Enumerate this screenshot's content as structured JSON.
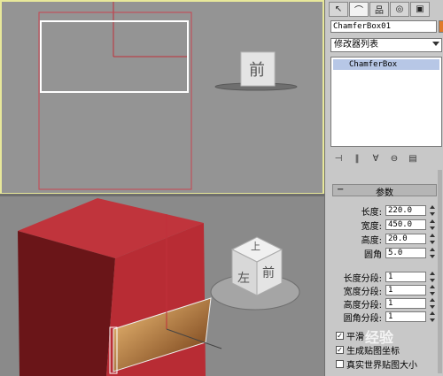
{
  "panel": {
    "tab_icons": [
      "cursor-icon",
      "curve-icon",
      "hierarchy-icon",
      "motion-icon",
      "display-icon"
    ],
    "object_name": "ChamferBox01",
    "modifier_list": "修改器列表",
    "stack_item": "ChamferBox",
    "params_title": "参数",
    "params": [
      {
        "label": "长度:",
        "value": "220.0"
      },
      {
        "label": "宽度:",
        "value": "450.0"
      },
      {
        "label": "高度:",
        "value": "20.0"
      },
      {
        "label": "圆角",
        "value": "5.0"
      }
    ],
    "segments": [
      {
        "label": "长度分段:",
        "value": "1"
      },
      {
        "label": "宽度分段:",
        "value": "1"
      },
      {
        "label": "高度分段:",
        "value": "1"
      },
      {
        "label": "圆角分段:",
        "value": "1"
      }
    ],
    "checkboxes": [
      {
        "label": "平滑",
        "checked": true
      },
      {
        "label": "生成贴图坐标",
        "checked": true
      },
      {
        "label": "真实世界贴图大小",
        "checked": false
      }
    ]
  },
  "viewport_top": {
    "cube_label": "前"
  },
  "viewport_persp": {
    "cube_front": "前",
    "cube_left": "左",
    "cube_top": "上"
  },
  "watermark": "经验"
}
